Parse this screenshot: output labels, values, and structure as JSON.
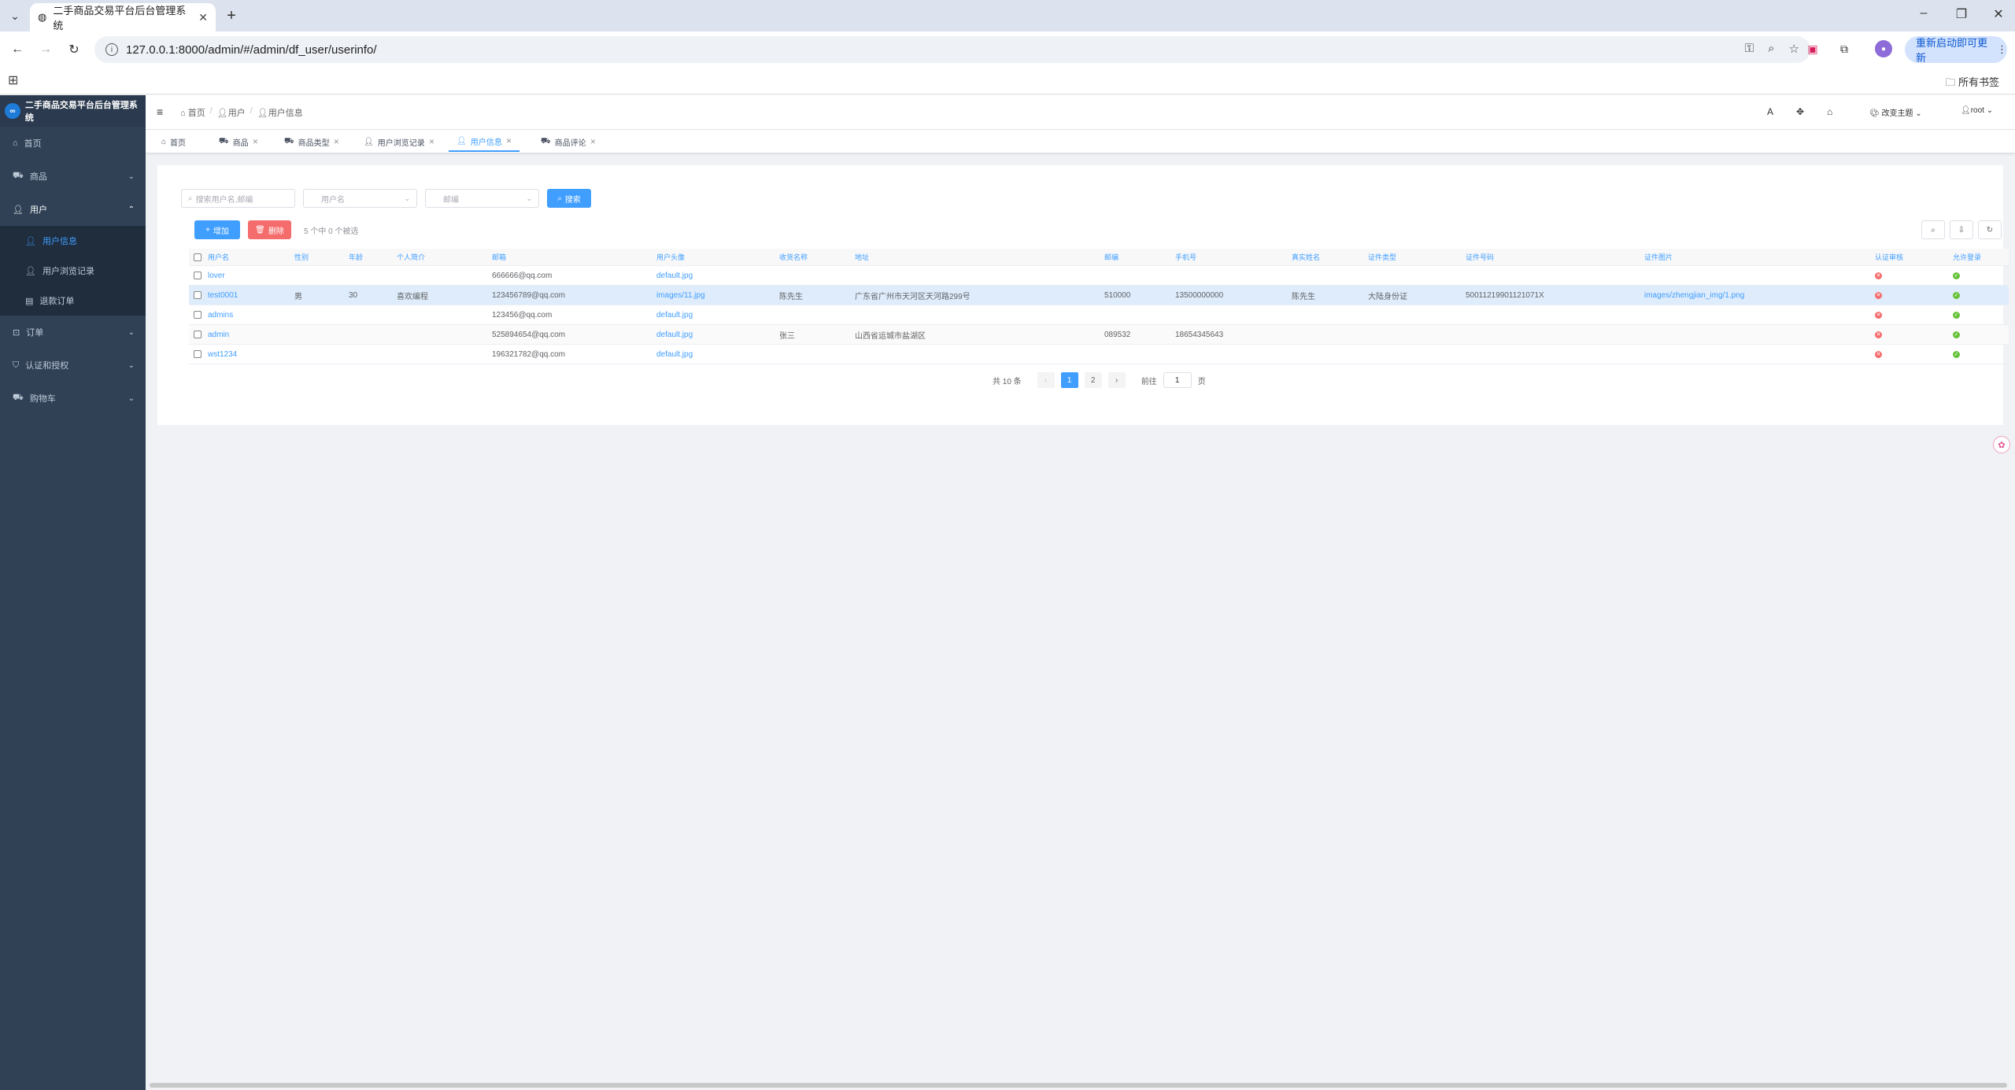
{
  "browser": {
    "tab_title": "二手商品交易平台后台管理系统",
    "url": "127.0.0.1:8000/admin/#/admin/df_user/userinfo/",
    "update_label": "重新启动即可更新",
    "bookmarks_label": "所有书签"
  },
  "sidebar": {
    "logo_text": "二手商品交易平台后台管理系统",
    "items": [
      {
        "label": "首页"
      },
      {
        "label": "商品"
      },
      {
        "label": "用户"
      },
      {
        "label": "订单"
      },
      {
        "label": "认证和授权"
      },
      {
        "label": "购物车"
      }
    ],
    "user_sub": [
      {
        "label": "用户信息"
      },
      {
        "label": "用户浏览记录"
      },
      {
        "label": "退款订单"
      }
    ]
  },
  "header": {
    "breadcrumb": [
      "首页",
      "用户",
      "用户信息"
    ],
    "theme_label": "改变主题",
    "user_label": "root"
  },
  "tags": [
    {
      "label": "首页"
    },
    {
      "label": "商品"
    },
    {
      "label": "商品类型"
    },
    {
      "label": "用户浏览记录"
    },
    {
      "label": "用户信息"
    },
    {
      "label": "商品评论"
    }
  ],
  "filter": {
    "search_placeholder": "搜索用户名,邮编",
    "username_placeholder": "用户名",
    "postcode_placeholder": "邮编",
    "search_btn": "搜索"
  },
  "toolbar": {
    "add_label": "增加",
    "delete_label": "删除",
    "selection_text": "5 个中 0 个被选"
  },
  "table": {
    "headers": [
      "用户名",
      "性别",
      "年龄",
      "个人简介",
      "邮箱",
      "用户头像",
      "收货名称",
      "地址",
      "邮编",
      "手机号",
      "真实姓名",
      "证件类型",
      "证件号码",
      "证件图片",
      "认证审核",
      "允许登录"
    ],
    "rows": [
      {
        "username": "lover",
        "gender": "",
        "age": "",
        "intro": "",
        "email": "666666@qq.com",
        "avatar": "default.jpg",
        "recv": "",
        "address": "",
        "postcode": "",
        "phone": "",
        "realname": "",
        "idtype": "",
        "idno": "",
        "idimg": "",
        "verified": false,
        "allow": true
      },
      {
        "username": "test0001",
        "gender": "男",
        "age": "30",
        "intro": "喜欢编程",
        "email": "123456789@qq.com",
        "avatar": "images/11.jpg",
        "recv": "陈先生",
        "address": "广东省广州市天河区天河路299号",
        "postcode": "510000",
        "phone": "13500000000",
        "realname": "陈先生",
        "idtype": "大陆身份证",
        "idno": "50011219901121071X",
        "idimg": "images/zhengjian_img/1.png",
        "verified": false,
        "allow": true
      },
      {
        "username": "admins",
        "gender": "",
        "age": "",
        "intro": "",
        "email": "123456@qq.com",
        "avatar": "default.jpg",
        "recv": "",
        "address": "",
        "postcode": "",
        "phone": "",
        "realname": "",
        "idtype": "",
        "idno": "",
        "idimg": "",
        "verified": false,
        "allow": true
      },
      {
        "username": "admin",
        "gender": "",
        "age": "",
        "intro": "",
        "email": "525894654@qq.com",
        "avatar": "default.jpg",
        "recv": "张三",
        "address": "山西省运城市盐湖区",
        "postcode": "089532",
        "phone": "18654345643",
        "realname": "",
        "idtype": "",
        "idno": "",
        "idimg": "",
        "verified": false,
        "allow": true
      },
      {
        "username": "wst1234",
        "gender": "",
        "age": "",
        "intro": "",
        "email": "196321782@qq.com",
        "avatar": "default.jpg",
        "recv": "",
        "address": "",
        "postcode": "",
        "phone": "",
        "realname": "",
        "idtype": "",
        "idno": "",
        "idimg": "",
        "verified": false,
        "allow": true
      }
    ]
  },
  "pagination": {
    "total_text": "共 10 条",
    "pages": [
      "1",
      "2"
    ],
    "current": "1",
    "goto_label": "前往",
    "goto_value": "1",
    "page_suffix": "页"
  },
  "colors": {
    "primary": "#409eff",
    "danger": "#f56c6c",
    "success": "#67c23a",
    "sidebar_bg": "#304156"
  }
}
